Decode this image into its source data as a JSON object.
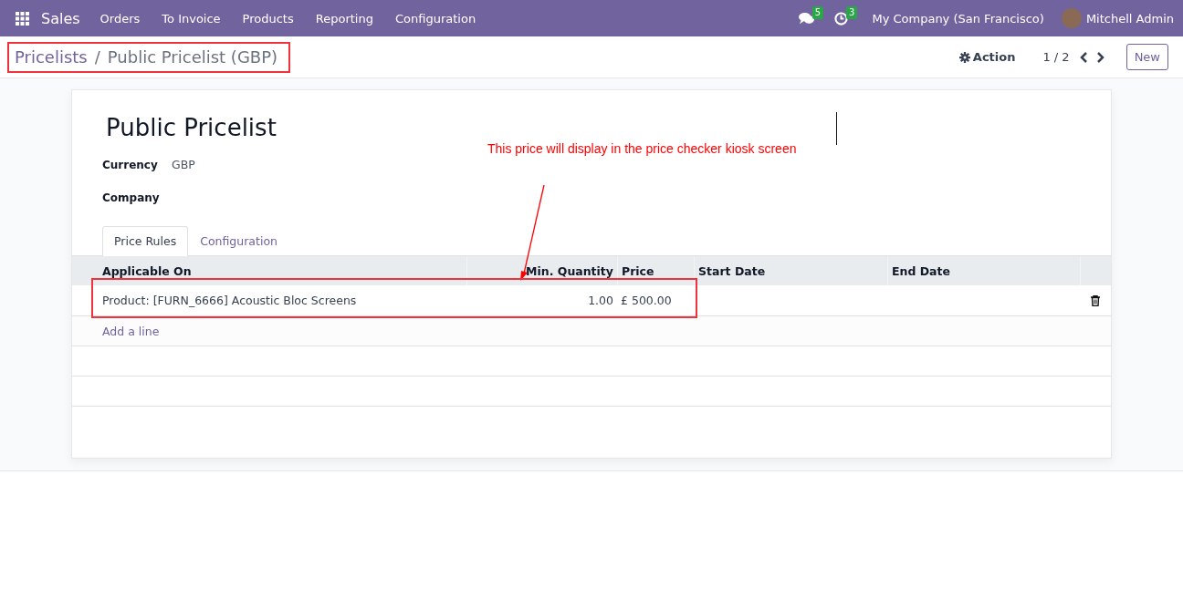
{
  "navbar": {
    "app_name": "Sales",
    "menu": [
      "Orders",
      "To Invoice",
      "Products",
      "Reporting",
      "Configuration"
    ],
    "messages_count": "5",
    "activities_count": "3",
    "company": "My Company (San Francisco)",
    "user": "Mitchell Admin"
  },
  "breadcrumb": {
    "parent": "Pricelists",
    "separator": "/",
    "current": "Public Pricelist (GBP)"
  },
  "control_panel": {
    "action": "Action",
    "pager": "1 / 2",
    "new_button": "New"
  },
  "form": {
    "title": "Public Pricelist",
    "fields": [
      {
        "label": "Currency",
        "value": "GBP"
      },
      {
        "label": "Company"
      }
    ],
    "tabs": [
      {
        "label": "Price Rules",
        "selected": true
      },
      {
        "label": "Configuration",
        "selected": false
      }
    ],
    "table": {
      "columns": [
        {
          "label": "Applicable On"
        },
        {
          "label": "Min. Quantity"
        },
        {
          "label": "Price"
        },
        {
          "label": "Start Date"
        },
        {
          "label": "End Date"
        }
      ],
      "rows": [
        {
          "cells": [
            "Product: [FURN_6666] Acoustic Bloc Screens",
            "1.00",
            "£ 500.00",
            "",
            ""
          ]
        }
      ],
      "add_line": "Add a line"
    }
  },
  "annotation": {
    "text": "This price will display in the price checker kiosk screen"
  }
}
